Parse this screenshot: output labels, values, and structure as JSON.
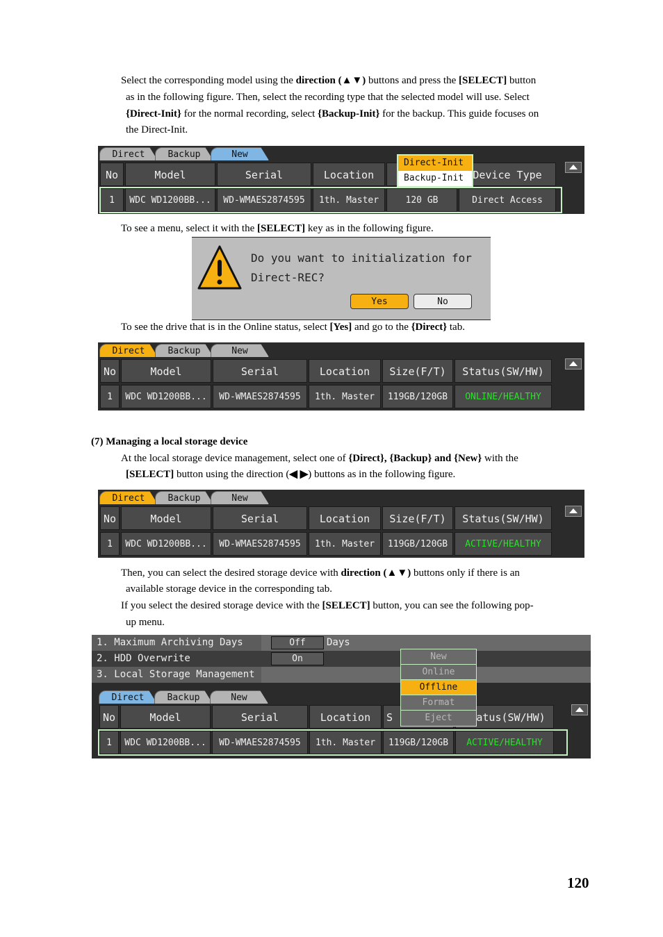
{
  "intro": {
    "segments": [
      "Select the corresponding model using the ",
      "direction (▲▼)",
      " buttons and press the ",
      "[SELECT]",
      " button",
      "as in the following figure.   Then, select the recording type that the selected model will use. Select",
      "{Direct-Init}",
      " for the normal recording, select ",
      "{Backup-Init}",
      " for the backup. This guide focuses on",
      "the Direct-Init."
    ]
  },
  "fig1": {
    "tabs": [
      "Direct",
      "Backup",
      "New"
    ],
    "active_tab": "New",
    "headers": [
      "No",
      "Model",
      "Serial",
      "Location",
      "",
      "Device Type"
    ],
    "row": [
      "1",
      "WDC WD1200BB...",
      "WD-WMAES2874595",
      "1th. Master",
      "120 GB",
      "Direct Access"
    ],
    "popup": [
      "Direct-Init",
      "Backup-Init"
    ],
    "popup_selected": "Direct-Init"
  },
  "para2": {
    "segments": [
      "To see a menu, select it with the ",
      "[SELECT]",
      " key as in the following figure."
    ]
  },
  "dialog": {
    "line1": "Do you want to initialization for",
    "line2": "Direct-REC?",
    "yes": "Yes",
    "no": "No"
  },
  "para3": {
    "segments": [
      "To see the drive that is in the Online status, select ",
      "[Yes]",
      " and go to the ",
      "{Direct}",
      " tab."
    ]
  },
  "fig2": {
    "tabs": [
      "Direct",
      "Backup",
      "New"
    ],
    "active_tab": "Direct",
    "headers": [
      "No",
      "Model",
      "Serial",
      "Location",
      "Size(F/T)",
      "Status(SW/HW)"
    ],
    "row": [
      "1",
      "WDC WD1200BB...",
      "WD-WMAES2874595",
      "1th. Master",
      "119GB/120GB",
      "ONLINE/HEALTHY"
    ]
  },
  "section7": {
    "heading": "(7)  Managing a local storage device",
    "segments": [
      "At the local storage device management, select one of ",
      "{Direct}, {Backup} and",
      " {New}",
      " with the",
      "[SELECT]",
      " button using the direction (",
      "◀ ▶",
      ") buttons as in the following figure."
    ]
  },
  "fig3": {
    "tabs": [
      "Direct",
      "Backup",
      "New"
    ],
    "active_tab": "Direct",
    "headers": [
      "No",
      "Model",
      "Serial",
      "Location",
      "Size(F/T)",
      "Status(SW/HW)"
    ],
    "row": [
      "1",
      "WDC WD1200BB...",
      "WD-WMAES2874595",
      "1th. Master",
      "119GB/120GB",
      "ACTIVE/HEALTHY"
    ]
  },
  "para4": {
    "segments": [
      "Then, you can select the desired storage device with ",
      "direction (▲▼)",
      " buttons only if there is an",
      "available storage device in the corresponding tab.",
      "If you select the desired storage device with the ",
      "[SELECT]",
      " button, you can see the following pop-",
      "up menu."
    ]
  },
  "fig4": {
    "menu": [
      {
        "label": "1. Maximum Archiving Days",
        "value": "Off",
        "unit": "Days"
      },
      {
        "label": "2. HDD Overwrite",
        "value": "On",
        "unit": ""
      },
      {
        "label": "3. Local Storage Management",
        "value": "",
        "unit": ""
      }
    ],
    "tabs": [
      "Direct",
      "Backup",
      "New"
    ],
    "active_tab": "Direct",
    "headers": [
      "No",
      "Model",
      "Serial",
      "Location",
      "S",
      "Status(SW/HW)"
    ],
    "row": [
      "1",
      "WDC WD1200BB...",
      "WD-WMAES2874595",
      "1th. Master",
      "119GB/120GB",
      "ACTIVE/HEALTHY"
    ],
    "context_menu": [
      "New",
      "Online",
      "Offline",
      "Format",
      "Eject"
    ],
    "context_selected": "Offline"
  },
  "page_number": "120",
  "colors": {
    "active_orange": "#f7b011",
    "tab_blue": "#7fb6e3",
    "status_green": "#2be02b",
    "selection_border": "#c8efc3"
  }
}
